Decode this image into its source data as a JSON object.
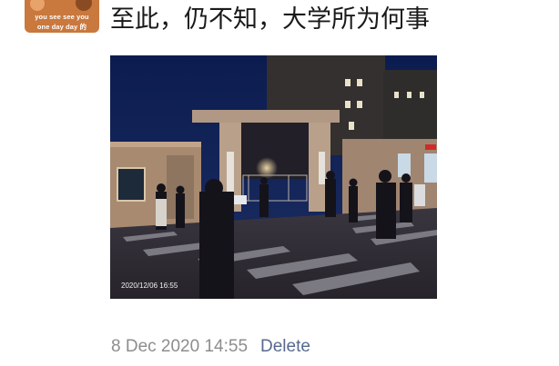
{
  "post": {
    "avatar": {
      "line1": "you see see you",
      "line2": "one day day 的"
    },
    "text": "至此，仍不知，大学所为何事",
    "photo": {
      "timestamp": "2020/12/06 16:55"
    },
    "time": "8 Dec 2020 14:55",
    "delete_label": "Delete"
  },
  "colors": {
    "time_gray": "#8d8d8d",
    "link_blue": "#57698f",
    "sky": "#0f1f52"
  }
}
